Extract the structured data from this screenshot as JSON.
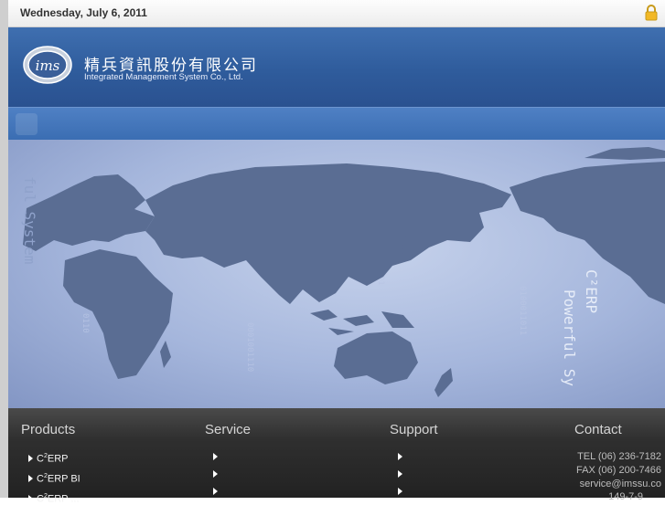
{
  "topbar": {
    "date": "Wednesday, July 6, 2011"
  },
  "header": {
    "logo_text": "ims",
    "company_cn": "精兵資訊股份有限公司",
    "company_en": "Integrated Management System Co., Ltd."
  },
  "banner": {
    "vertical_text_left": "ful System",
    "product_tag": "C²ERP",
    "tagline": "Powerful Sy"
  },
  "footer": {
    "products": {
      "title": "Products",
      "items": [
        {
          "base": "C",
          "sup": "2",
          "rest": "ERP"
        },
        {
          "base": "C",
          "sup": "2",
          "rest": "ERP BI"
        },
        {
          "base": "C",
          "sup": "2",
          "rest": "ERP ..."
        }
      ]
    },
    "service": {
      "title": "Service"
    },
    "support": {
      "title": "Support"
    },
    "contact": {
      "title": "Contact",
      "tel": "TEL (06) 236-7182",
      "fax": "FAX (06) 200-7466",
      "email": "service@imssu.co",
      "address": "149-7-9"
    }
  },
  "colors": {
    "header_blue": "#2f5c9c",
    "map_bg": "#a5b6dc",
    "land": "#5a6d93",
    "footer": "#2f2f2f"
  }
}
